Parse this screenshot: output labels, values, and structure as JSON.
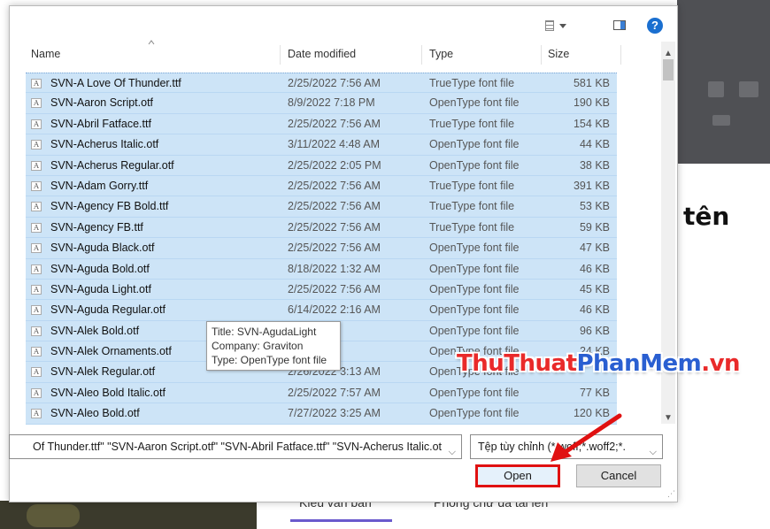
{
  "background": {
    "heading_fragment": "tên",
    "tabs": [
      "Kiểu văn bản",
      "Phông chữ đã tải lên"
    ]
  },
  "dialog": {
    "columns": {
      "name": "Name",
      "date": "Date modified",
      "type": "Type",
      "size": "Size"
    },
    "files": [
      {
        "name": "SVN-A Love Of Thunder.ttf",
        "date": "2/25/2022 7:56 AM",
        "type": "TrueType font file",
        "size": "581 KB"
      },
      {
        "name": "SVN-Aaron Script.otf",
        "date": "8/9/2022 7:18 PM",
        "type": "OpenType font file",
        "size": "190 KB"
      },
      {
        "name": "SVN-Abril Fatface.ttf",
        "date": "2/25/2022 7:56 AM",
        "type": "TrueType font file",
        "size": "154 KB"
      },
      {
        "name": "SVN-Acherus Italic.otf",
        "date": "3/11/2022 4:48 AM",
        "type": "OpenType font file",
        "size": "44 KB"
      },
      {
        "name": "SVN-Acherus Regular.otf",
        "date": "2/25/2022 2:05 PM",
        "type": "OpenType font file",
        "size": "38 KB"
      },
      {
        "name": "SVN-Adam Gorry.ttf",
        "date": "2/25/2022 7:56 AM",
        "type": "TrueType font file",
        "size": "391 KB"
      },
      {
        "name": "SVN-Agency FB Bold.ttf",
        "date": "2/25/2022 7:56 AM",
        "type": "TrueType font file",
        "size": "53 KB"
      },
      {
        "name": "SVN-Agency FB.ttf",
        "date": "2/25/2022 7:56 AM",
        "type": "TrueType font file",
        "size": "59 KB"
      },
      {
        "name": "SVN-Aguda Black.otf",
        "date": "2/25/2022 7:56 AM",
        "type": "OpenType font file",
        "size": "47 KB"
      },
      {
        "name": "SVN-Aguda Bold.otf",
        "date": "8/18/2022 1:32 AM",
        "type": "OpenType font file",
        "size": "46 KB"
      },
      {
        "name": "SVN-Aguda Light.otf",
        "date": "2/25/2022 7:56 AM",
        "type": "OpenType font file",
        "size": "45 KB"
      },
      {
        "name": "SVN-Aguda Regular.otf",
        "date": "6/14/2022 2:16 AM",
        "type": "OpenType font file",
        "size": "46 KB"
      },
      {
        "name": "SVN-Alek Bold.otf",
        "date": "7:57 AM",
        "type": "OpenType font file",
        "size": "96 KB"
      },
      {
        "name": "SVN-Alek Ornaments.otf",
        "date": "11:08 AM",
        "type": "OpenType font file",
        "size": "24 KB"
      },
      {
        "name": "SVN-Alek Regular.otf",
        "date": "2/26/2022 3:13 AM",
        "type": "OpenType font file",
        "size": ""
      },
      {
        "name": "SVN-Aleo Bold Italic.otf",
        "date": "2/25/2022 7:57 AM",
        "type": "OpenType font file",
        "size": "77 KB"
      },
      {
        "name": "SVN-Aleo Bold.otf",
        "date": "7/27/2022 3:25 AM",
        "type": "OpenType font file",
        "size": "120 KB"
      }
    ],
    "tooltip": {
      "title": "Title: SVN-AgudaLight",
      "company": "Company: Graviton",
      "type": "Type: OpenType font file"
    },
    "file_name_value": "Of Thunder.ttf\" \"SVN-Aaron Script.otf\" \"SVN-Abril Fatface.ttf\" \"SVN-Acherus Italic.ot",
    "file_type_value": "Tệp tùy chỉnh (*.woff;*.woff2;*.",
    "open_label": "Open",
    "cancel_label": "Cancel"
  },
  "watermark": {
    "part1": "ThuThuat",
    "part2": "PhanMem",
    "part3": ".vn"
  },
  "colors": {
    "selection": "#cde4f7",
    "highlight_border": "#e01111",
    "accent": "#1a6fd0"
  }
}
